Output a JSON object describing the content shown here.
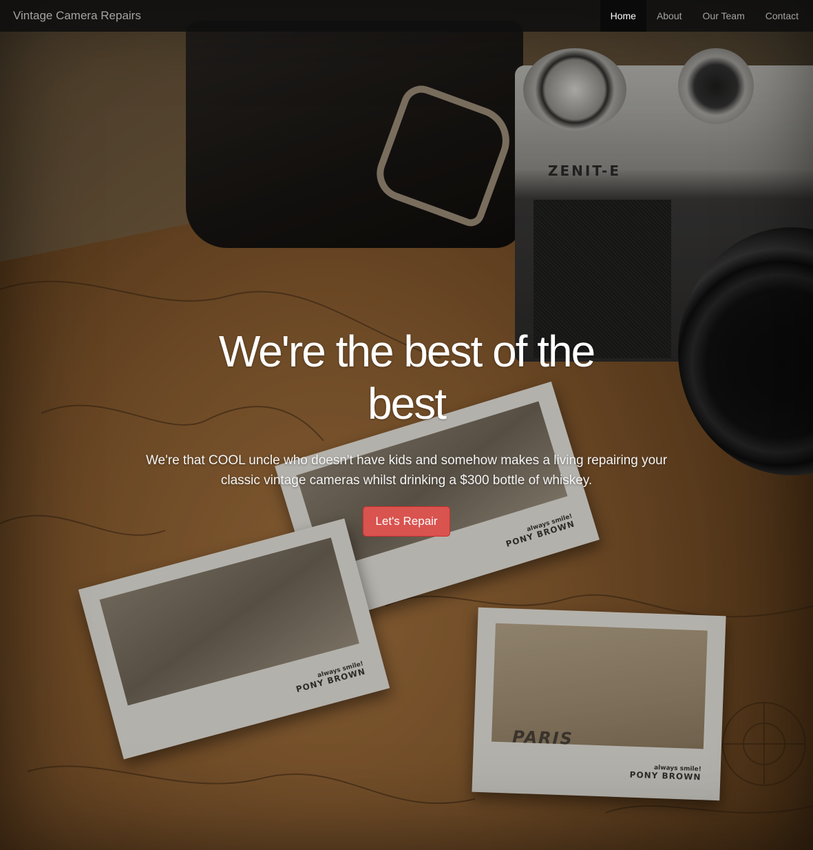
{
  "navbar": {
    "brand": "Vintage Camera Repairs",
    "links": [
      {
        "label": "Home",
        "active": true
      },
      {
        "label": "About",
        "active": false
      },
      {
        "label": "Our Team",
        "active": false
      },
      {
        "label": "Contact",
        "active": false
      }
    ]
  },
  "hero": {
    "title": "We're the best of the best",
    "subtitle": "We're that COOL uncle who doesn't have kids and somehow makes a living repairing your classic vintage cameras whilst drinking a $300 bottle of whiskey.",
    "cta_label": "Let's Repair"
  },
  "background_photo": {
    "camera_brand": "ZENIT-E",
    "polaroid_caption_small": "always smile!",
    "polaroid_caption_big": "PONY BROWN",
    "polaroid_city": "PARIS"
  },
  "colors": {
    "navbar_bg": "#0f0f0f",
    "nav_active_bg": "#0a0a0a",
    "cta_bg": "#d9534f"
  }
}
